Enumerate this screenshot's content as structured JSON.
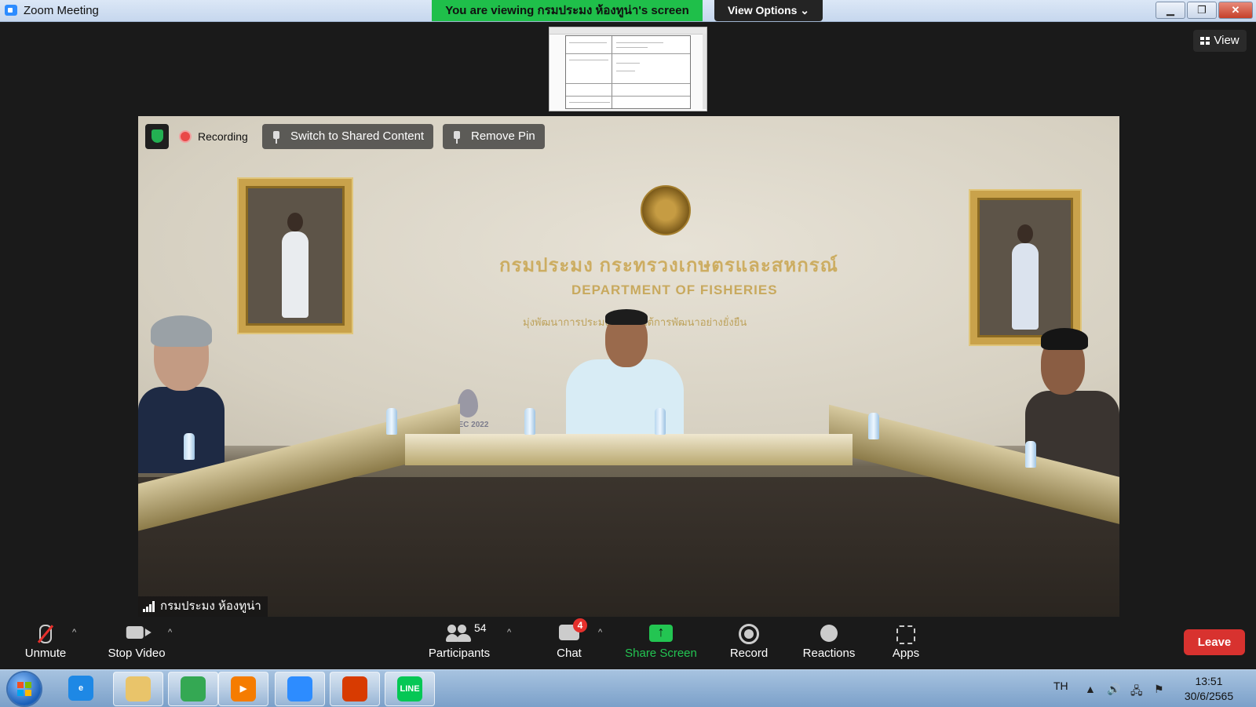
{
  "window": {
    "title": "Zoom Meeting",
    "viewing_banner": "You are viewing กรมประมง ห้องทูน่า's screen",
    "view_options": "View Options ⌄",
    "minimize": "▁",
    "restore": "❐",
    "close": "✕"
  },
  "top_right": {
    "view_label": "View"
  },
  "video": {
    "recording_label": "Recording",
    "switch_shared_label": "Switch to Shared Content",
    "remove_pin_label": "Remove Pin",
    "participant_name": "กรมประมง ห้องทูน่า",
    "wall_text_th": "กรมประมง กระทรวงเกษตรและสหกรณ์",
    "wall_text_en": "DEPARTMENT OF FISHERIES",
    "wall_text_sub": "มุ่งพัฒนาการประมง ... ภายใต้การพัฒนาอย่างยั่งยืน",
    "apec_label": "APEC 2022"
  },
  "toolbar": {
    "unmute_label": "Unmute",
    "stop_video_label": "Stop Video",
    "participants_label": "Participants",
    "participants_count": "54",
    "chat_label": "Chat",
    "chat_badge": "4",
    "share_screen_label": "Share Screen",
    "record_label": "Record",
    "reactions_label": "Reactions",
    "apps_label": "Apps",
    "leave_label": "Leave",
    "caret": "^"
  },
  "taskbar": {
    "apps": [
      {
        "name": "internet-explorer",
        "label": "e",
        "color": "#1e88e5"
      },
      {
        "name": "file-explorer",
        "label": "",
        "color": "#e9c46a"
      },
      {
        "name": "chrome",
        "label": "",
        "color": "#34a853"
      },
      {
        "name": "media-player",
        "label": "▶",
        "color": "#f57c00"
      },
      {
        "name": "zoom",
        "label": "",
        "color": "#2d8cff"
      },
      {
        "name": "office",
        "label": "",
        "color": "#d83b01"
      },
      {
        "name": "line",
        "label": "LINE",
        "color": "#06c755"
      }
    ],
    "language": "TH",
    "time": "13:51",
    "date": "30/6/2565"
  },
  "colors": {
    "banner_green": "#1fbf4a",
    "share_green": "#23c552",
    "leave_red": "#d8322f",
    "badge_red": "#e5302c"
  }
}
